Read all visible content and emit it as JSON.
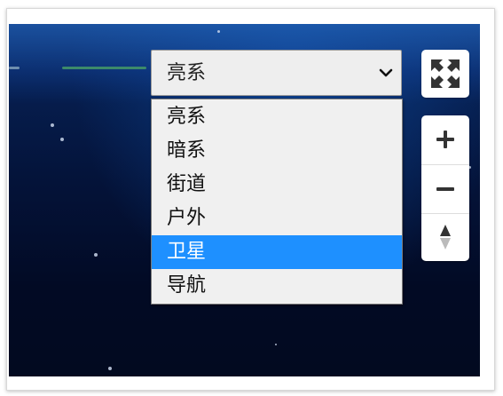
{
  "style_select": {
    "current": "亮系",
    "options": [
      "亮系",
      "暗系",
      "街道",
      "户外",
      "卫星",
      "导航"
    ],
    "highlighted": "卫星",
    "highlight_color": "#1e90ff"
  },
  "controls": {
    "fullscreen_icon": "fullscreen-icon",
    "zoom_in_icon": "plus-icon",
    "zoom_out_icon": "minus-icon",
    "compass_icon": "compass-icon"
  }
}
